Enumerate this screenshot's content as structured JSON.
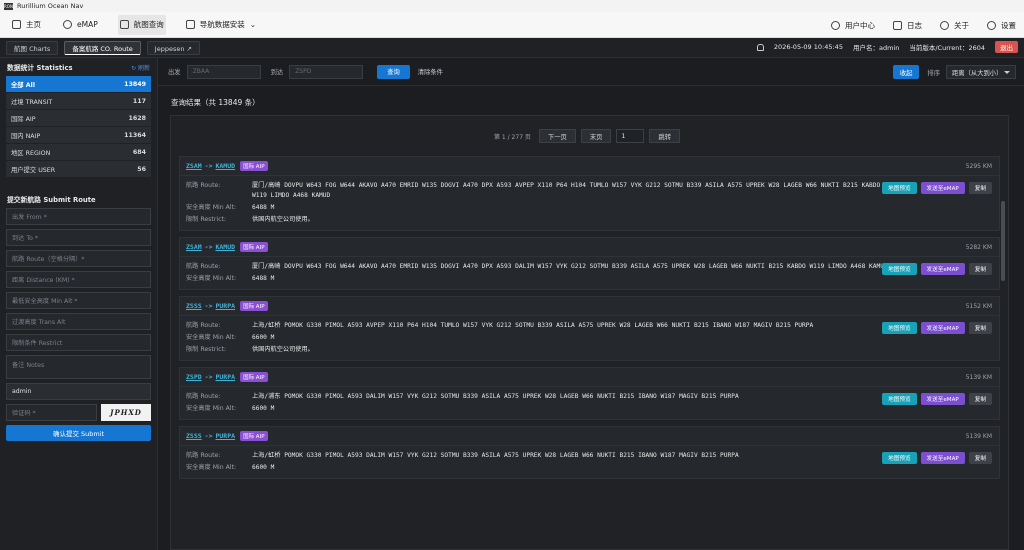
{
  "app": {
    "title": "Rurillium Ocean Nav",
    "icon_text": "RON"
  },
  "menu": {
    "left": [
      {
        "label": "主页",
        "icon": "home-icon"
      },
      {
        "label": "eMAP",
        "icon": "globe-icon"
      },
      {
        "label": "航图查询",
        "icon": "document-icon",
        "active": true
      },
      {
        "label": "导航数据安装",
        "icon": "download-icon",
        "has_dropdown": true
      }
    ],
    "right": [
      {
        "label": "用户中心",
        "icon": "user-icon"
      },
      {
        "label": "日志",
        "icon": "log-icon"
      },
      {
        "label": "关于",
        "icon": "help-icon"
      },
      {
        "label": "设置",
        "icon": "gear-icon"
      }
    ]
  },
  "tabs": [
    {
      "label": "航图 Charts"
    },
    {
      "label": "备案航路 CO. Route",
      "active": true
    },
    {
      "label": "Jeppesen ↗"
    }
  ],
  "status": {
    "datetime": "2026-05-09 10:45:45",
    "user": "用户名：admin",
    "version": "当前版本/Current：2604",
    "logout": "退出"
  },
  "sidebar": {
    "stats_title": "数据统计 Statistics",
    "refresh": "↻ 刷新",
    "stats": [
      {
        "label": "全部 All",
        "count": "13849",
        "active": true
      },
      {
        "label": "过境 TRANSIT",
        "count": "117"
      },
      {
        "label": "国际 AIP",
        "count": "1628"
      },
      {
        "label": "国内 NAIP",
        "count": "11364"
      },
      {
        "label": "地区 REGION",
        "count": "684"
      },
      {
        "label": "用户提交 USER",
        "count": "56"
      }
    ],
    "submit_title": "提交新航路 Submit Route",
    "fields": {
      "from": "出发 From *",
      "to": "到达 To *",
      "route": "航路 Route（空格分隔）*",
      "distance": "距离 Distance (KM) *",
      "min_alt": "最低安全高度 Min Alt *",
      "trans_alt": "过渡高度 Trans Alt",
      "restrict": "限制条件 Restrict",
      "notes": "备注 Notes",
      "username": "admin",
      "captcha": "验证码 *"
    },
    "captcha_text": "JPHXD",
    "submit_label": "确认提交 Submit"
  },
  "filter": {
    "from_label": "出发",
    "from_placeholder": "ZBAA",
    "to_label": "到达",
    "to_placeholder": "ZSPD",
    "query": "查询",
    "clear": "清除条件",
    "collapse": "收起",
    "sort_label": "排序",
    "sort_value": "距离（从大到小）"
  },
  "results": {
    "title": "查询结果（共 13849 条）",
    "pager": {
      "info": "第 1 / 277 页",
      "next": "下一页",
      "last": "末页",
      "page": "1",
      "jump": "跳转"
    },
    "labels": {
      "route": "航路 Route:",
      "min_alt": "安全高度 Min Alt:",
      "restrict": "限制 Restrict:",
      "map": "地图预览",
      "emap": "发送至eMAP",
      "copy": "复制"
    },
    "items": [
      {
        "from": "ZSAM",
        "to": "KAMUD",
        "badge": "国际 AIP",
        "distance": "5295 KM",
        "route": "厦门/高崎 DOVPU W643 FOG W644 AKAVO A470 EMRID W135 DOGVI A470 DPX A593 AVPEP X110 P64 H104 TUMLO W157 VYK G212 SOTMU B339 ASILA A575 UPREK W28 LAGEB W66 NUKTI B215 KABDO W119 LIMDO A468 KAMUD",
        "min_alt": "6488 M",
        "restrict": "供国内航空公司使用。"
      },
      {
        "from": "ZSAM",
        "to": "KAMUD",
        "badge": "国际 AIP",
        "distance": "5282 KM",
        "route": "厦门/高崎 DOVPU W643 FOG W644 AKAVO A470 EMRID W135 DOGVI A470 DPX A593 DALIM W157 VYK G212 SOTMU B339 ASILA A575 UPREK W28 LAGEB W66 NUKTI B215 KABDO W119 LIMDO A468 KAMUD",
        "min_alt": "6488 M",
        "restrict": ""
      },
      {
        "from": "ZSSS",
        "to": "PURPA",
        "badge": "国际 AIP",
        "distance": "5152 KM",
        "route": "上海/虹桥 POMOK G330 PIMOL A593 AVPEP X110 P64 H104 TUMLO W157 VYK G212 SOTMU B339 ASILA A575 UPREK W28 LAGEB W66 NUKTI B215 IBANO W187 MAGIV B215 PURPA",
        "min_alt": "6600 M",
        "restrict": "供国内航空公司使用。"
      },
      {
        "from": "ZSPD",
        "to": "PURPA",
        "badge": "国际 AIP",
        "distance": "5139 KM",
        "route": "上海/浦东 POMOK G330 PIMOL A593 DALIM W157 VYK G212 SOTMU B339 ASILA A575 UPREK W28 LAGEB W66 NUKTI B215 IBANO W187 MAGIV B215 PURPA",
        "min_alt": "6600 M",
        "restrict": ""
      },
      {
        "from": "ZSSS",
        "to": "PURPA",
        "badge": "国际 AIP",
        "distance": "5139 KM",
        "route": "上海/虹桥 POMOK G330 PIMOL A593 DALIM W157 VYK G212 SOTMU B339 ASILA A575 UPREK W28 LAGEB W66 NUKTI B215 IBANO W187 MAGIV B215 PURPA",
        "min_alt": "6600 M",
        "restrict": ""
      }
    ]
  },
  "colors": {
    "accent": "#1677d2",
    "badge": "#8a4fd3",
    "map_btn": "#17a2b8",
    "emap_btn": "#7b4fcf",
    "danger": "#d9534f"
  }
}
